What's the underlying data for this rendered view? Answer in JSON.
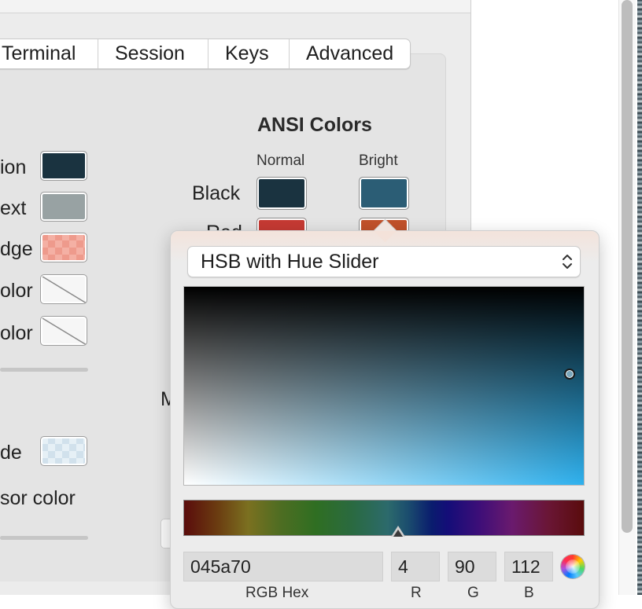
{
  "tabs": [
    "Terminal",
    "Session",
    "Keys",
    "Advanced"
  ],
  "left_rows": [
    {
      "label": "ion",
      "swatch": "dark"
    },
    {
      "label": "ext",
      "swatch": "gray"
    },
    {
      "label": "dge",
      "swatch": "checker"
    },
    {
      "label": "olor",
      "swatch": "none"
    },
    {
      "label": "olor",
      "swatch": "none"
    }
  ],
  "left_lower": {
    "mode_label": "de",
    "cursor_label": "sor color"
  },
  "ansi": {
    "title": "ANSI Colors",
    "col_normal": "Normal",
    "col_bright": "Bright",
    "row_black": "Black",
    "row_red_partial": "Red",
    "colors": {
      "black_normal": "#1a3340",
      "black_bright": "#2b5d75",
      "red_normal": "#c63a33",
      "red_bright": "#c1512a"
    }
  },
  "cutoff_letter": "M",
  "picker": {
    "mode": "HSB with Hue Slider",
    "hex_value": "045a70",
    "r_value": "4",
    "g_value": "90",
    "b_value": "112",
    "hex_label": "RGB Hex",
    "r_label": "R",
    "g_label": "G",
    "b_label": "B",
    "hue_color": "#2fb1ee",
    "saturation": 0.96,
    "brightness": 0.44,
    "hue_degrees": 193
  }
}
